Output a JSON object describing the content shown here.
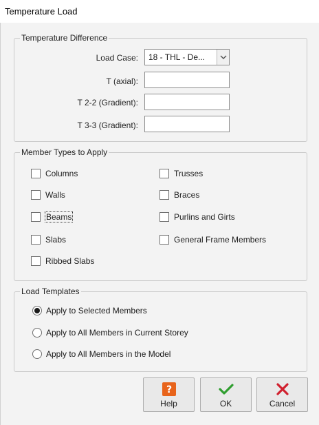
{
  "window": {
    "title": "Temperature Load"
  },
  "temperature_difference": {
    "legend": "Temperature Difference",
    "load_case": {
      "label": "Load Case:",
      "value": "18 - THL - De..."
    },
    "t_axial": {
      "label": "T (axial):",
      "value": ""
    },
    "t22": {
      "label": "T 2-2 (Gradient):",
      "value": ""
    },
    "t33": {
      "label": "T 3-3 (Gradient):",
      "value": ""
    }
  },
  "member_types": {
    "legend": "Member Types to Apply",
    "items": [
      {
        "label": "Columns",
        "checked": false
      },
      {
        "label": "Walls",
        "checked": false
      },
      {
        "label": "Beams",
        "checked": false
      },
      {
        "label": "Slabs",
        "checked": false
      },
      {
        "label": "Ribbed Slabs",
        "checked": false
      },
      {
        "label": "Trusses",
        "checked": false
      },
      {
        "label": "Braces",
        "checked": false
      },
      {
        "label": "Purlins and Girts",
        "checked": false
      },
      {
        "label": "General Frame Members",
        "checked": false
      }
    ]
  },
  "load_templates": {
    "legend": "Load Templates",
    "options": [
      {
        "label": "Apply to Selected Members",
        "selected": true
      },
      {
        "label": "Apply to All Members in Current Storey",
        "selected": false
      },
      {
        "label": "Apply to All Members in the Model",
        "selected": false
      }
    ]
  },
  "buttons": {
    "help": {
      "label": "Help",
      "icon": "help-icon",
      "color": "#e8641b"
    },
    "ok": {
      "label": "OK",
      "icon": "checkmark-icon",
      "color": "#2f9e2f"
    },
    "cancel": {
      "label": "Cancel",
      "icon": "close-icon",
      "color": "#d0202e"
    }
  }
}
